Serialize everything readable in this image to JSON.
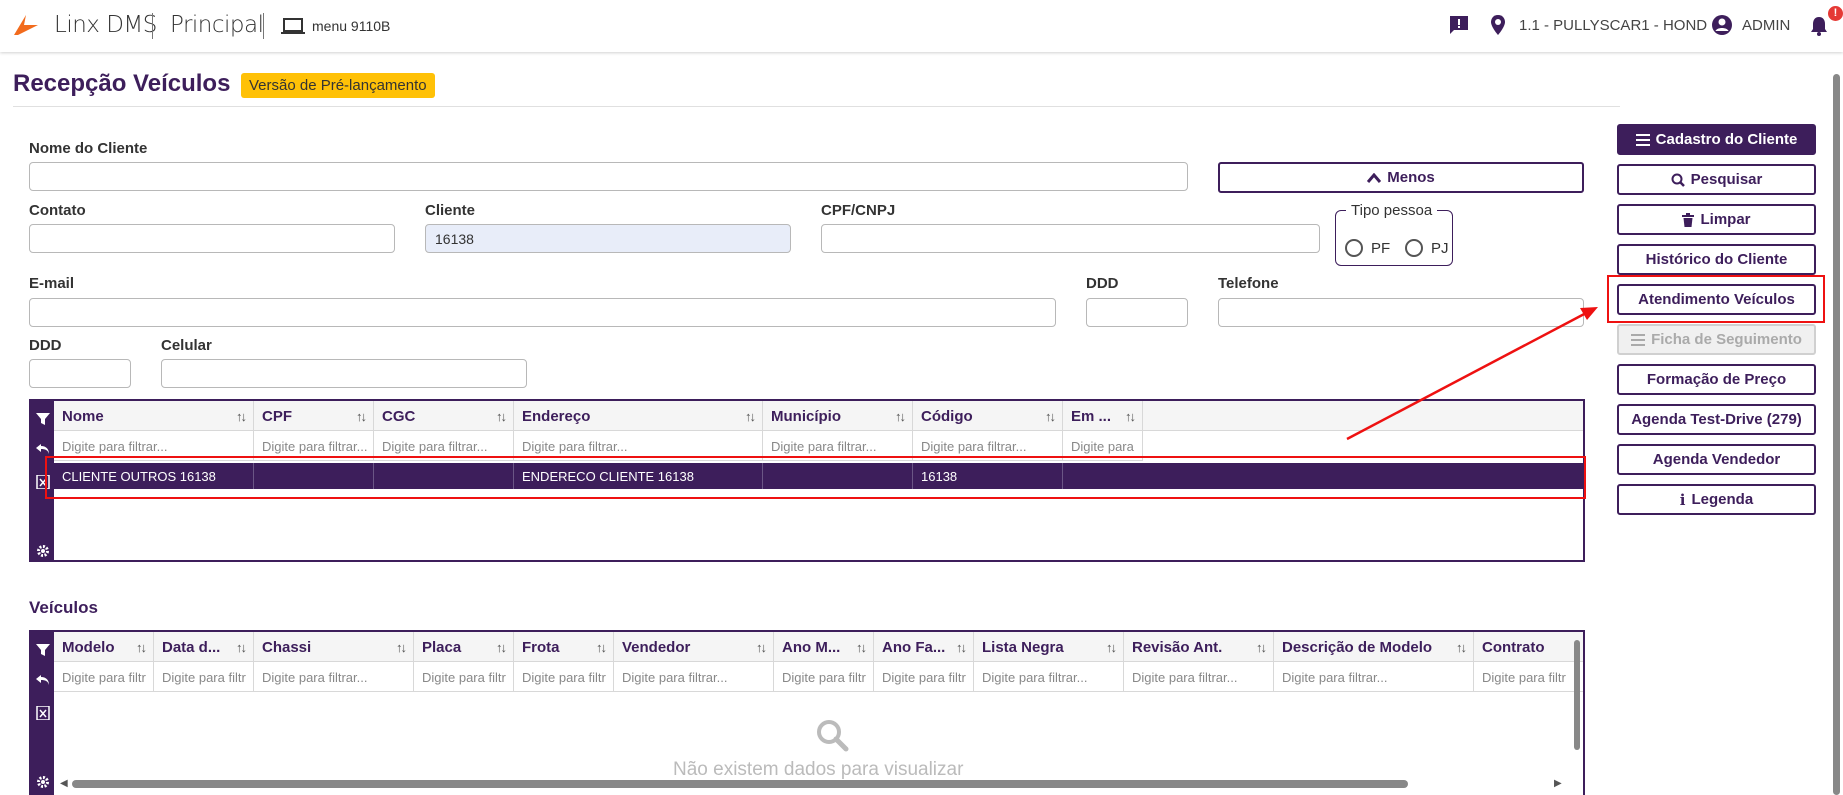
{
  "header": {
    "brand": "Linx DMS",
    "module": "Principal",
    "menu_label": "menu 9110B",
    "location": "1.1 - PULLYSCAR1 - HOND",
    "user": "ADMIN",
    "notification_count": "!"
  },
  "page": {
    "title": "Recepção Veículos",
    "prerelease_badge": "Versão de Pré-lançamento"
  },
  "form": {
    "nome_cliente": {
      "label": "Nome do Cliente",
      "value": ""
    },
    "contato": {
      "label": "Contato",
      "value": ""
    },
    "cliente": {
      "label": "Cliente",
      "value": "16138"
    },
    "cpf_cnpj": {
      "label": "CPF/CNPJ",
      "value": ""
    },
    "tipo_pessoa": {
      "legend": "Tipo pessoa",
      "options": [
        "PF",
        "PJ"
      ]
    },
    "email": {
      "label": "E-mail",
      "value": ""
    },
    "ddd1": {
      "label": "DDD",
      "value": ""
    },
    "telefone": {
      "label": "Telefone",
      "value": ""
    },
    "ddd2": {
      "label": "DDD",
      "value": ""
    },
    "celular": {
      "label": "Celular",
      "value": ""
    },
    "menos_button": "Menos"
  },
  "actions": {
    "cadastro_cliente": "Cadastro do Cliente",
    "pesquisar": "Pesquisar",
    "limpar": "Limpar",
    "historico_cliente": "Histórico do Cliente",
    "atendimento_veiculos": "Atendimento Veículos",
    "ficha_seguimento": "Ficha de Seguimento",
    "formacao_preco": "Formação de Preço",
    "agenda_test_drive": "Agenda Test-Drive (279)",
    "agenda_vendedor": "Agenda Vendedor",
    "legenda": "Legenda"
  },
  "clients_grid": {
    "columns": [
      "Nome",
      "CPF",
      "CGC",
      "Endereço",
      "Município",
      "Código",
      "Em ..."
    ],
    "filter_placeholder": "Digite para filtrar...",
    "filter_placeholder_short": "Digite para",
    "rows": [
      {
        "nome": "CLIENTE OUTROS 16138",
        "cpf": "",
        "cgc": "",
        "endereco": "ENDERECO CLIENTE 16138",
        "municipio": "",
        "codigo": "16138",
        "em": ""
      }
    ]
  },
  "vehicles_grid": {
    "title": "Veículos",
    "columns": [
      "Modelo",
      "Data d...",
      "Chassi",
      "Placa",
      "Frota",
      "Vendedor",
      "Ano M...",
      "Ano Fa...",
      "Lista Negra",
      "Revisão Ant.",
      "Descrição de Modelo",
      "Contrato"
    ],
    "filter_placeholders": [
      "Digite para filtr",
      "Digite para filtr",
      "Digite para filtrar...",
      "Digite para filtr",
      "Digite para filtr",
      "Digite para filtrar...",
      "Digite para filtr",
      "Digite para filtr",
      "Digite para filtrar...",
      "Digite para filtrar...",
      "Digite para filtrar...",
      "Digite para filtr"
    ],
    "empty_message": "Não existem dados para visualizar"
  },
  "colors": {
    "primary": "#3d1e5b",
    "badge": "#ffc107",
    "annotation": "#e11111",
    "brand_orange": "#f26b1d"
  }
}
